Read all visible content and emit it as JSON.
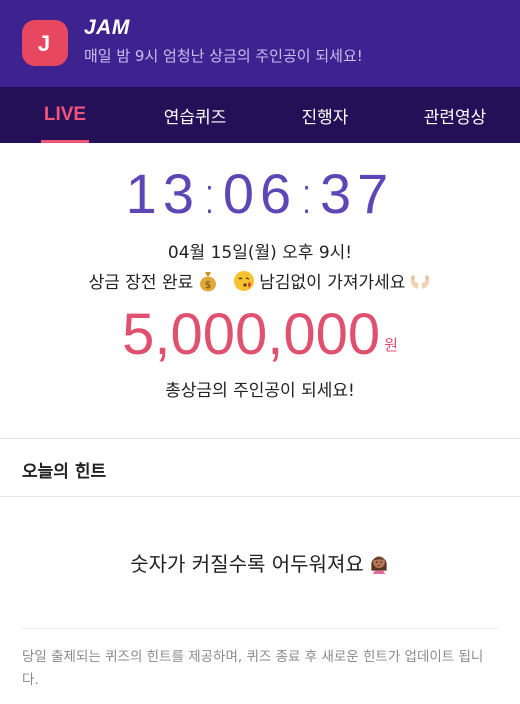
{
  "header": {
    "logo_letter": "J",
    "app_title": "JAM",
    "subtitle": "매일 밤 9시 엄청난 상금의 주인공이 되세요!"
  },
  "tabs": [
    {
      "label": "LIVE",
      "active": true
    },
    {
      "label": "연습퀴즈",
      "active": false
    },
    {
      "label": "진행자",
      "active": false
    },
    {
      "label": "관련영상",
      "active": false
    }
  ],
  "countdown": {
    "hh": "13",
    "mm": "06",
    "ss": "37"
  },
  "schedule_line": "04월 15일(월) 오후 9시!",
  "promo_line": {
    "part1": "상금 장전 완료",
    "part2": "남김없이 가져가세요",
    "icons": [
      "money-bag-icon",
      "kiss-face-icon",
      "palms-up-icon"
    ]
  },
  "prize": {
    "amount": "5,000,000",
    "unit": "원",
    "caption": "총상금의 주인공이 되세요!"
  },
  "hint": {
    "section_title": "오늘의 힌트",
    "text": "숫자가 커질수록 어두워져요",
    "icon": "woman-tipping-hand-icon"
  },
  "notice": "당일 출제되는 퀴즈의 힌트를 제공하며, 퀴즈 종료 후 새로운 힌트가 업데이트 됩니다.",
  "colors": {
    "header_bg": "#3d2290",
    "tabbar_bg": "#241057",
    "accent_pink": "#f0547a",
    "clock_purple": "#5b47b6",
    "prize_red": "#e0506f"
  }
}
